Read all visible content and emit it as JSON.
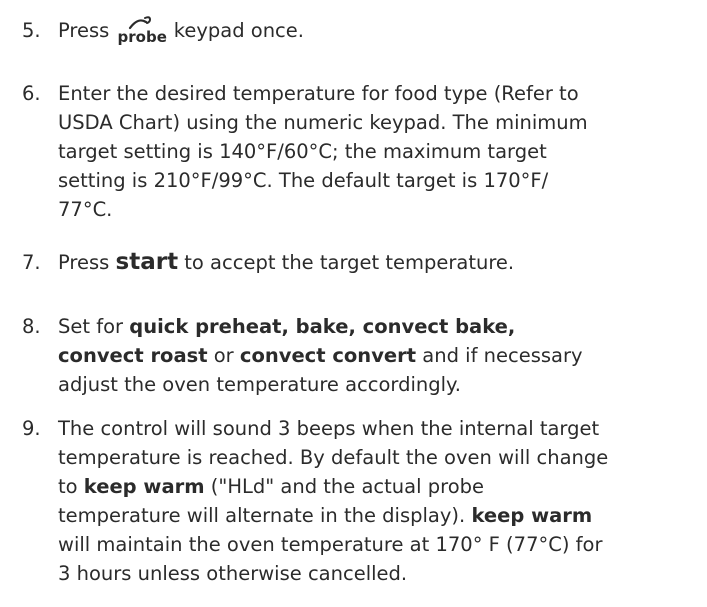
{
  "steps": {
    "s5": {
      "num": "5.",
      "pre": "Press",
      "icon_word": "probe",
      "icon": "probe-icon",
      "post": "keypad once."
    },
    "s6": {
      "num": "6.",
      "line1": "Enter the desired temperature for food type (Refer to",
      "line2": "USDA Chart) using the numeric keypad. The minimum",
      "line3": "target setting is 140°F/60°C; the maximum target",
      "line4": "setting is 210°F/99°C. The default target is 170°F/",
      "line5": "77°C."
    },
    "s7": {
      "num": "7.",
      "pre": "Press",
      "key": "start",
      "post": "to accept the target temperature."
    },
    "s8": {
      "num": "8.",
      "pre": "Set for",
      "m1": "quick preheat, bake, convect bake,",
      "m2": "convect roast",
      "or": "or",
      "m3": "convect convert",
      "post": "and if necessary",
      "line3": "adjust the oven temperature accordingly."
    },
    "s9": {
      "num": "9.",
      "line1": "The control will sound 3 beeps when the internal target",
      "line2": "temperature is reached. By default the oven will change",
      "to": "to",
      "kw1": "keep warm",
      "line3_rest": "(\"HLd\" and the actual probe",
      "line4_pre": "temperature will alternate in the display).",
      "kw2": "keep warm",
      "line5": "will maintain the oven temperature at 170° F (77°C) for",
      "line6": "3 hours unless otherwise cancelled."
    }
  }
}
